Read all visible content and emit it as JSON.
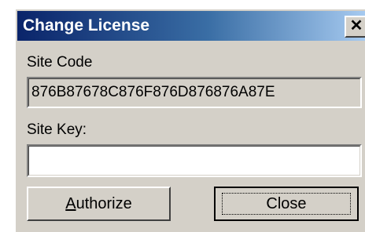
{
  "dialog": {
    "title": "Change License",
    "close_glyph": "✕",
    "close_icon": "close-icon"
  },
  "site_code": {
    "label": "Site Code",
    "value": "876B87678C876F876D876876A87E"
  },
  "site_key": {
    "label": "Site Key:",
    "value": "",
    "placeholder": ""
  },
  "buttons": {
    "authorize": {
      "mnemonic": "A",
      "rest": "uthorize"
    },
    "close": "Close"
  },
  "colors": {
    "title_start": "#0a246a",
    "title_end": "#a6caf0",
    "face": "#d4d0c8"
  }
}
